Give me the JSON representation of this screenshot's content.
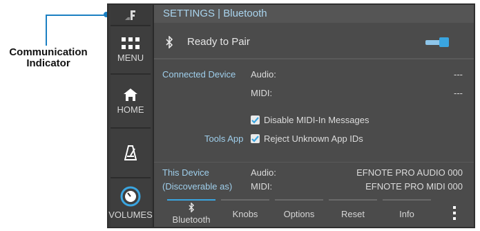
{
  "callout": {
    "line1": "Communication",
    "line2": "Indicator"
  },
  "sidebar": {
    "items": [
      {
        "label": "MENU",
        "icon": "grid-icon"
      },
      {
        "label": "HOME",
        "icon": "home-icon"
      },
      {
        "label": "",
        "icon": "metronome-icon"
      },
      {
        "label": "VOLUMES",
        "icon": "volume-knob-icon"
      }
    ]
  },
  "header": {
    "title": "SETTINGS | Bluetooth"
  },
  "pairing": {
    "status": "Ready to Pair",
    "toggle_on": true
  },
  "connected": {
    "label": "Connected Device",
    "audio_label": "Audio:",
    "audio_value": "---",
    "midi_label": "MIDI:",
    "midi_value": "---"
  },
  "tools": {
    "label": "Tools App",
    "option1": "Disable MIDI-In Messages",
    "option2": "Reject Unknown App IDs"
  },
  "this_device": {
    "label_line1": "This Device",
    "label_line2": "(Discoverable as)",
    "audio_label": "Audio:",
    "audio_value": "EFNOTE PRO AUDIO 000",
    "midi_label": "MIDI:",
    "midi_value": "EFNOTE PRO MIDI 000"
  },
  "tabs": [
    "Bluetooth",
    "Knobs",
    "Options",
    "Reset",
    "Info"
  ],
  "colors": {
    "accent": "#3aa5e0",
    "label_blue": "#9fcfec",
    "background": "#4b4b4b"
  }
}
